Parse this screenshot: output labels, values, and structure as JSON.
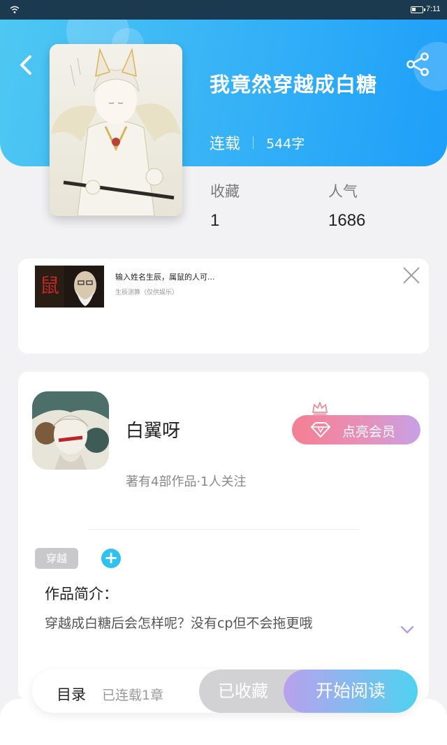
{
  "statusbar": {
    "time": "7:11"
  },
  "book": {
    "title": "我竟然穿越成白糖",
    "status": "连载",
    "word_count": "544字",
    "stats": {
      "favorites_label": "收藏",
      "favorites_value": "1",
      "popularity_label": "人气",
      "popularity_value": "1686"
    }
  },
  "ad": {
    "title": "输入姓名生辰，属鼠的人可...",
    "subtitle": "生辰测算（仅供娱乐）",
    "thumb_glyph": "鼠"
  },
  "author": {
    "name": "白翼呀",
    "meta": "著有4部作品·1人关注",
    "vip_label": "点亮会员"
  },
  "tags": [
    "穿越"
  ],
  "tag_add": "+",
  "intro": {
    "heading": "作品简介：",
    "text": "穿越成白糖后会怎样呢？没有cp但不会拖更哦"
  },
  "bottom": {
    "toc_label": "目录",
    "toc_count": "已连载1章",
    "collected_label": "已收藏",
    "read_label": "开始阅读"
  },
  "colors": {
    "header_start": "#4ec8f2",
    "header_end": "#1e9ff9",
    "accent_cyan": "#2fc2ee",
    "vip_pink": "#f47f93",
    "vip_purple": "#c8a0e6"
  },
  "icons": [
    "wifi-icon",
    "battery-icon",
    "back-icon",
    "share-icon",
    "close-icon",
    "crown-icon",
    "diamond-icon",
    "plus-icon",
    "chevron-down-icon"
  ]
}
